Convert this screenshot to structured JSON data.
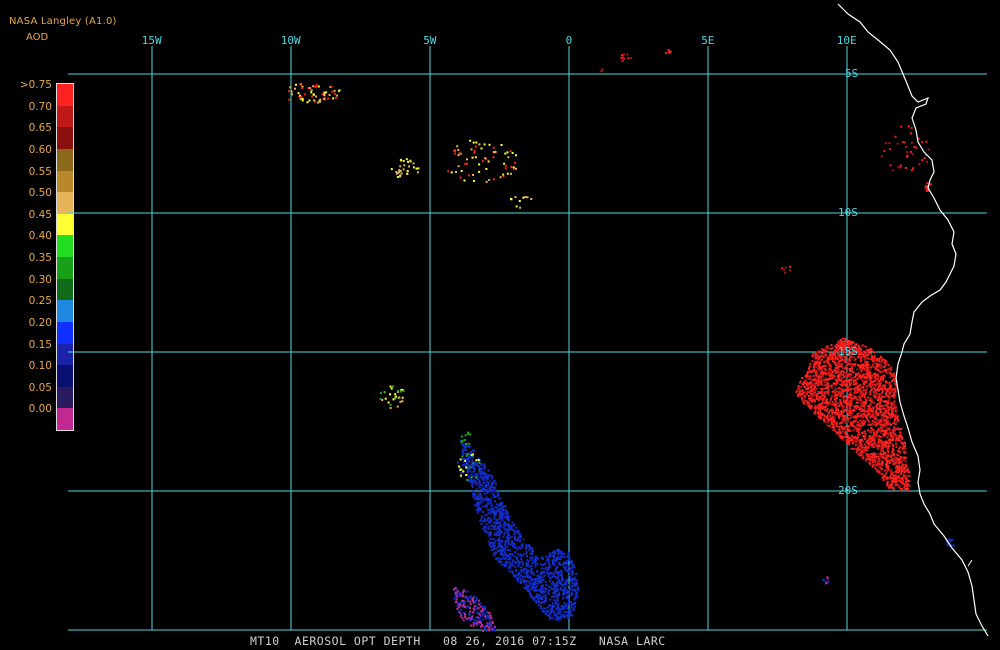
{
  "header": {
    "title": "NASA Langley (A1.0)",
    "subtitle": "AOD"
  },
  "legend": {
    "labels": [
      ">0.75",
      "0.70",
      "0.65",
      "0.60",
      "0.55",
      "0.50",
      "0.45",
      "0.40",
      "0.35",
      "0.30",
      "0.25",
      "0.20",
      "0.15",
      "0.10",
      "0.05",
      "0.00"
    ],
    "colors": [
      "#ff2020",
      "#c01818",
      "#8a1010",
      "#8a6a1a",
      "#b8882a",
      "#e6b45a",
      "#ffff33",
      "#22dd22",
      "#19a019",
      "#0f6a1a",
      "#1e88e0",
      "#1030ff",
      "#1a22aa",
      "#0a1070",
      "#2a1a60",
      "#c02a90"
    ]
  },
  "grid": {
    "lon_labels": [
      "15W",
      "10W",
      "5W",
      "0",
      "5E",
      "10E"
    ],
    "lat_labels": [
      "5S",
      "10S",
      "15S",
      "20S"
    ],
    "color": "#4fd8e0"
  },
  "map": {
    "coastline_color": "#ffffff",
    "aerosol_colors": {
      "high": "#ff2020",
      "medium_dark": "#a01818",
      "orange": "#e6b45a",
      "yellow": "#ffff33",
      "green": "#22aa22",
      "blue": "#1030d0",
      "navy": "#1a22aa",
      "magenta": "#c02a90"
    }
  },
  "footer": {
    "text": "MT10  AEROSOL OPT DEPTH   08 26, 2016 07:15Z   NASA LARC"
  }
}
